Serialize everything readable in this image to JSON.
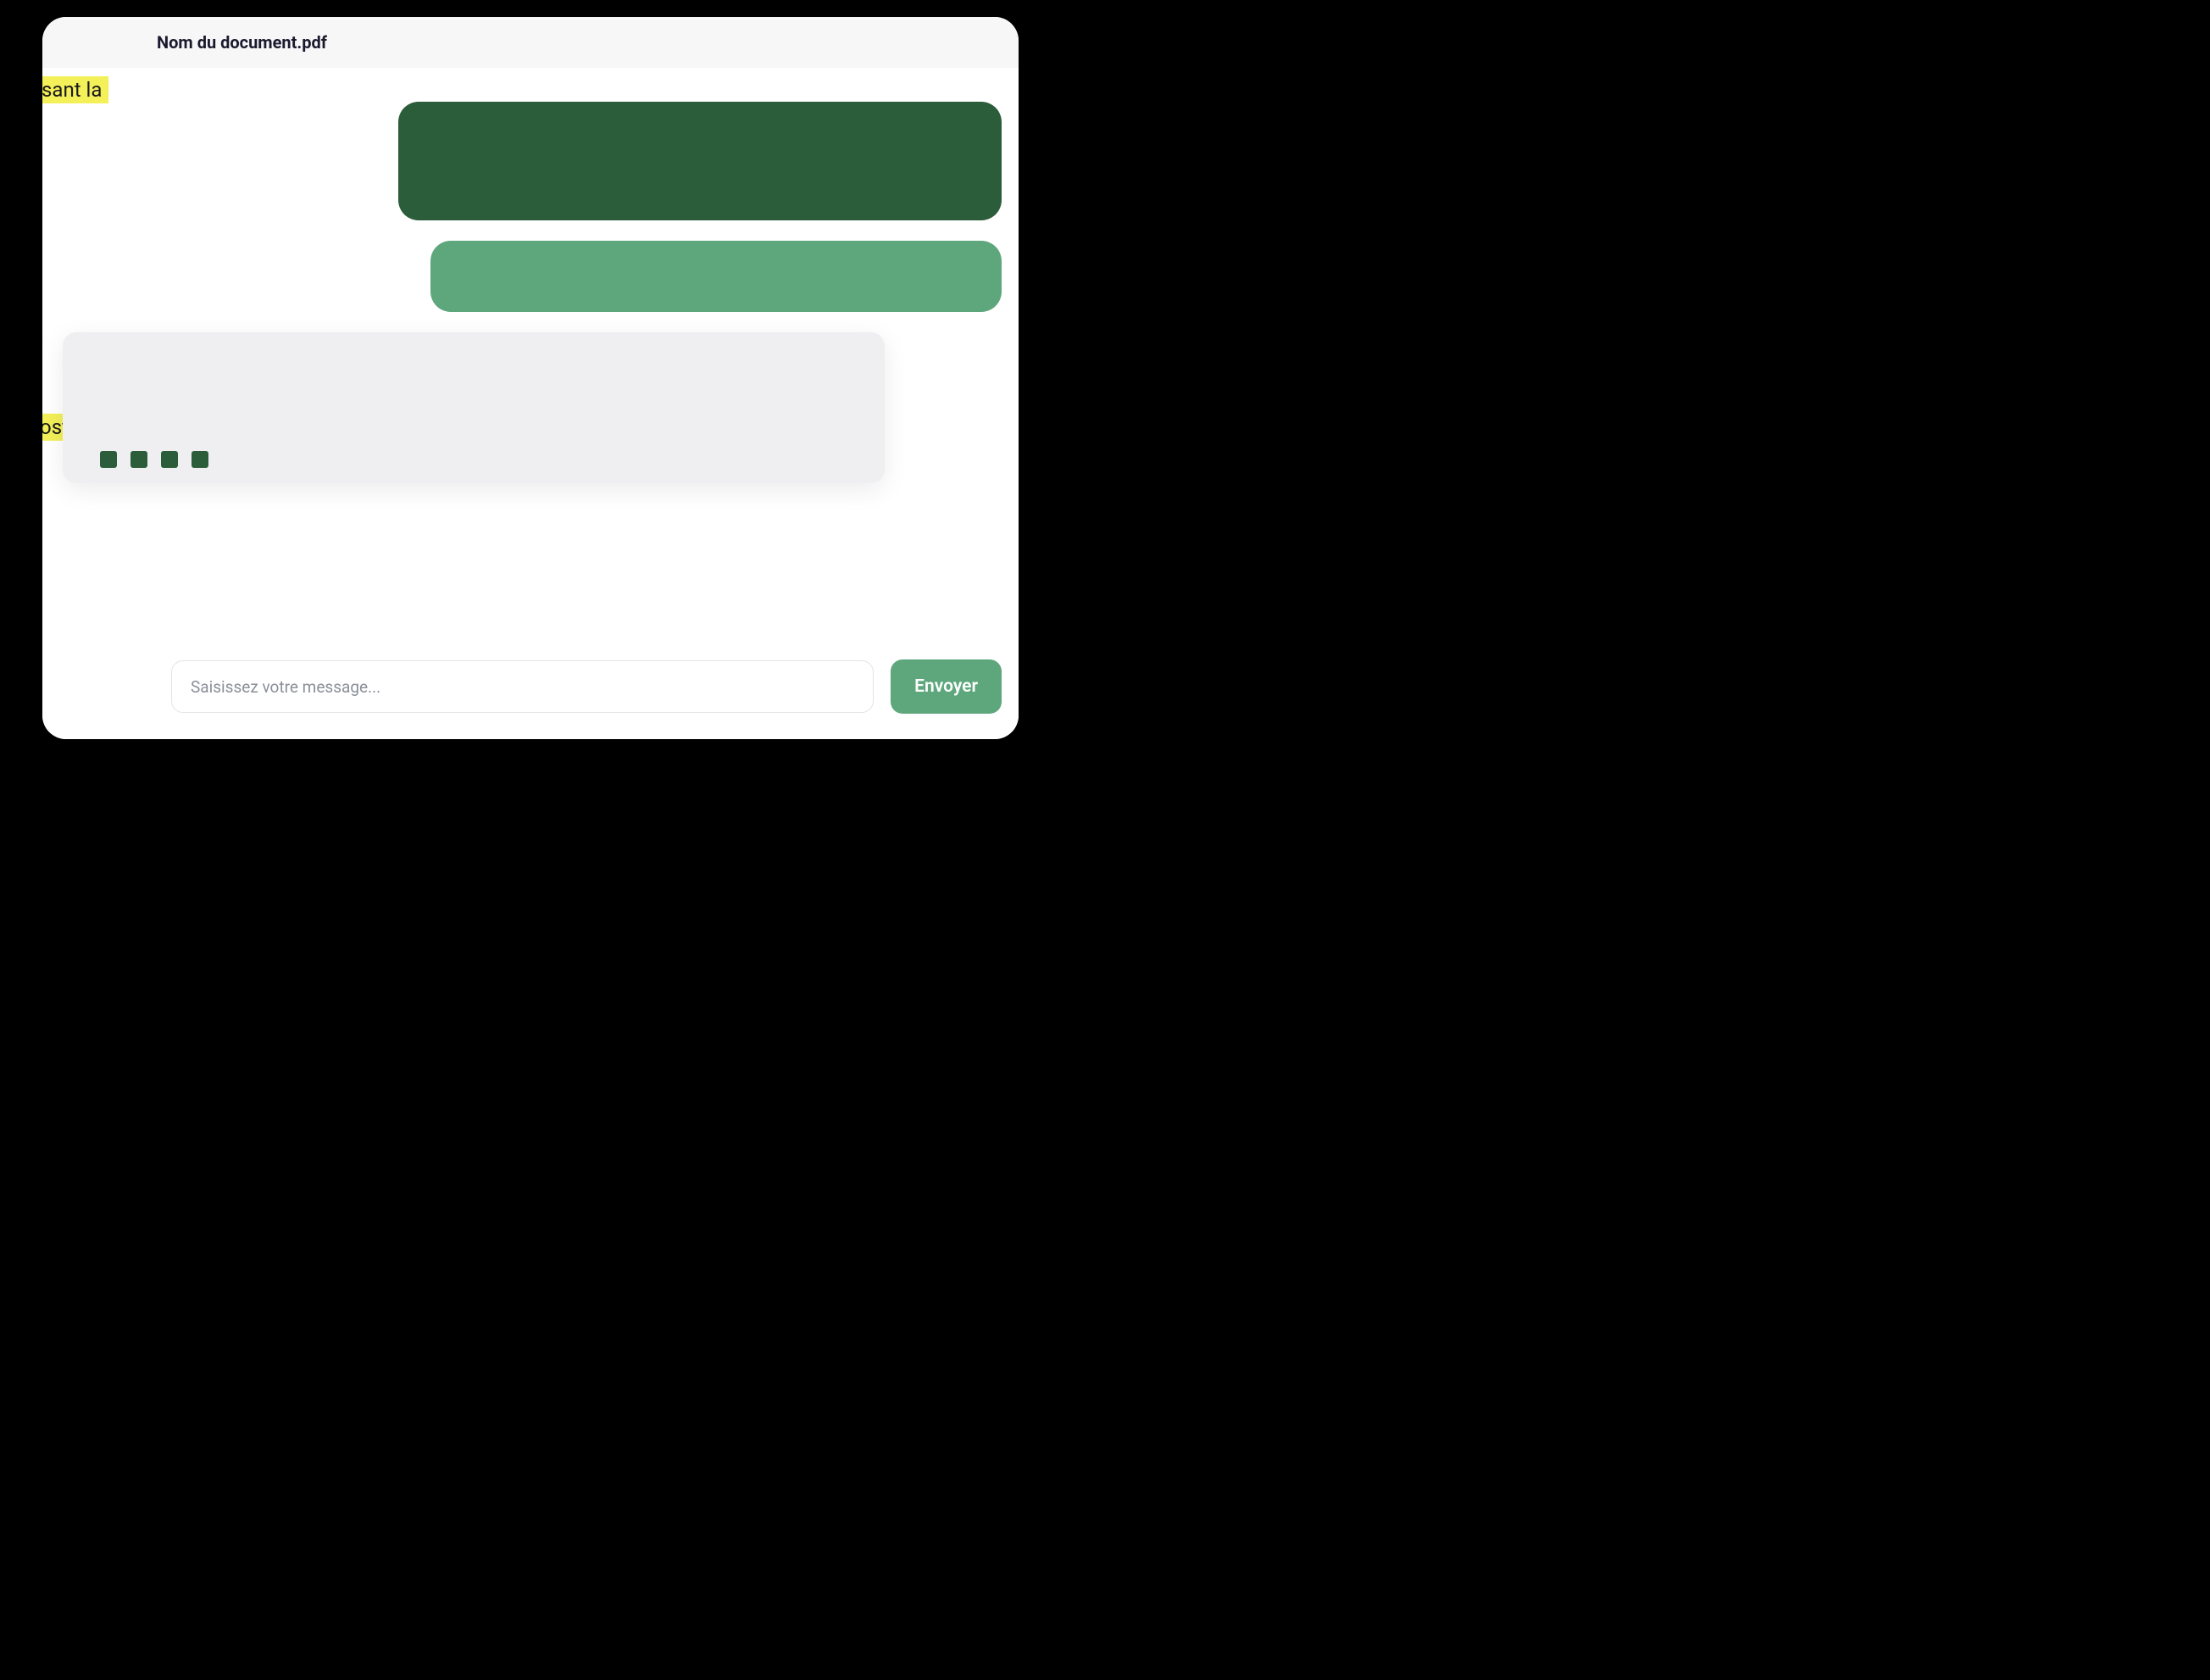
{
  "header": {
    "document_title": "Nom du document.pdf"
  },
  "background_highlights": {
    "highlight_1": "sant la",
    "highlight_2": "ost"
  },
  "chat": {
    "messages": [
      {
        "role": "user",
        "variant": "dark",
        "text": ""
      },
      {
        "role": "user",
        "variant": "light",
        "text": ""
      }
    ],
    "typing_indicator": {
      "visible": true,
      "dot_count": 4
    }
  },
  "input": {
    "placeholder": "Saisissez votre message...",
    "value": "",
    "send_label": "Envoyer"
  },
  "colors": {
    "bubble_dark": "#2c5d3a",
    "bubble_light": "#5ea77c",
    "highlight": "#f3f05a",
    "send_button": "#5ea77c",
    "response_bg": "#efeff2"
  }
}
